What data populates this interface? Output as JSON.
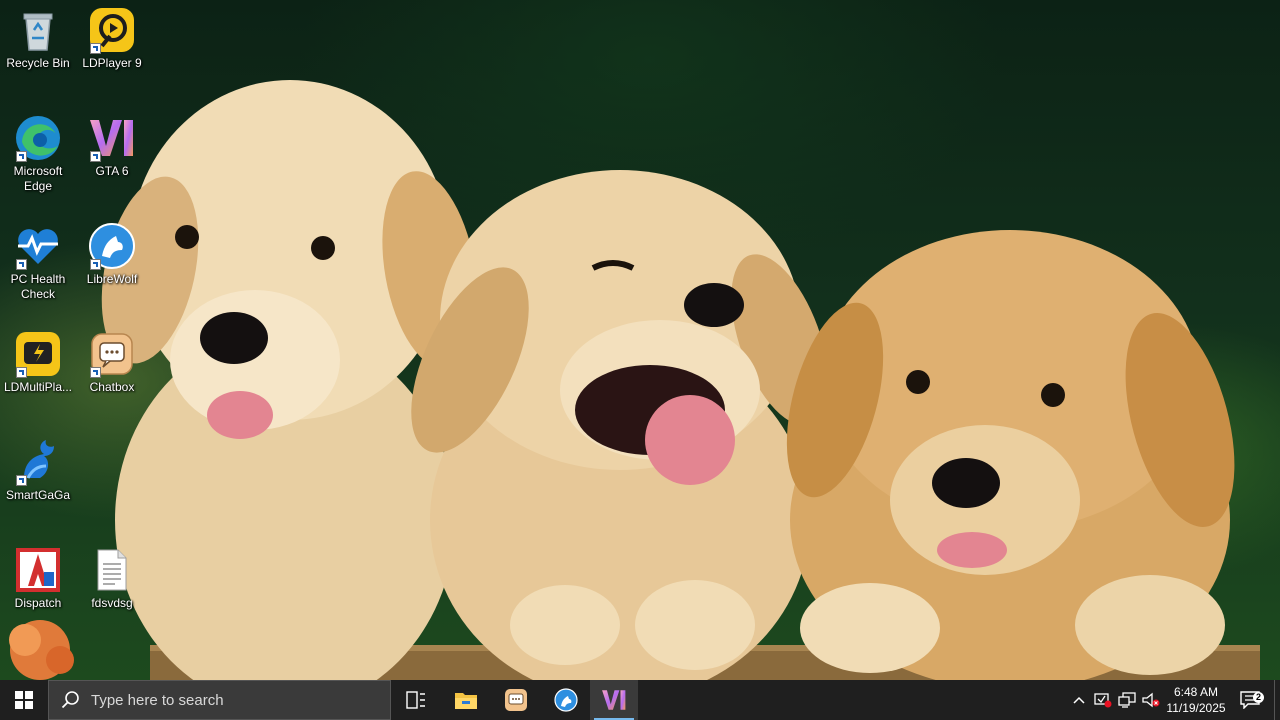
{
  "desktop": {
    "icons": [
      {
        "label": "Recycle Bin",
        "icon": "recycle-bin-icon"
      },
      {
        "label": "LDPlayer 9",
        "icon": "ldplayer-icon"
      },
      {
        "label": "Microsoft Edge",
        "icon": "edge-icon"
      },
      {
        "label": "GTA 6",
        "icon": "gta6-icon"
      },
      {
        "label": "PC Health Check",
        "icon": "pc-health-check-icon"
      },
      {
        "label": "LibreWolf",
        "icon": "librewolf-icon"
      },
      {
        "label": "LDMultiPla...",
        "icon": "ldmultiplayer-icon"
      },
      {
        "label": "Chatbox",
        "icon": "chatbox-icon"
      },
      {
        "label": "SmartGaGa",
        "icon": "smartgaga-icon"
      },
      {
        "label": "Dispatch",
        "icon": "dispatch-icon"
      },
      {
        "label": "fdsvdsg",
        "icon": "text-file-icon"
      }
    ],
    "wallpaper": "golden retriever puppies"
  },
  "taskbar": {
    "search_placeholder": "Type here to search",
    "apps": [
      {
        "name": "Task View",
        "icon": "task-view-icon"
      },
      {
        "name": "File Explorer",
        "icon": "file-explorer-icon"
      },
      {
        "name": "Chatbox",
        "icon": "chatbox-icon"
      },
      {
        "name": "LibreWolf",
        "icon": "librewolf-icon"
      },
      {
        "name": "GTA 6",
        "icon": "gta6-icon",
        "active": true
      }
    ],
    "tray": {
      "time": "6:48 AM",
      "date": "11/19/2025",
      "notification_count": "2"
    }
  },
  "colors": {
    "taskbar_bg": "#1f1f1f",
    "active_app_underline": "#76b9ed"
  }
}
